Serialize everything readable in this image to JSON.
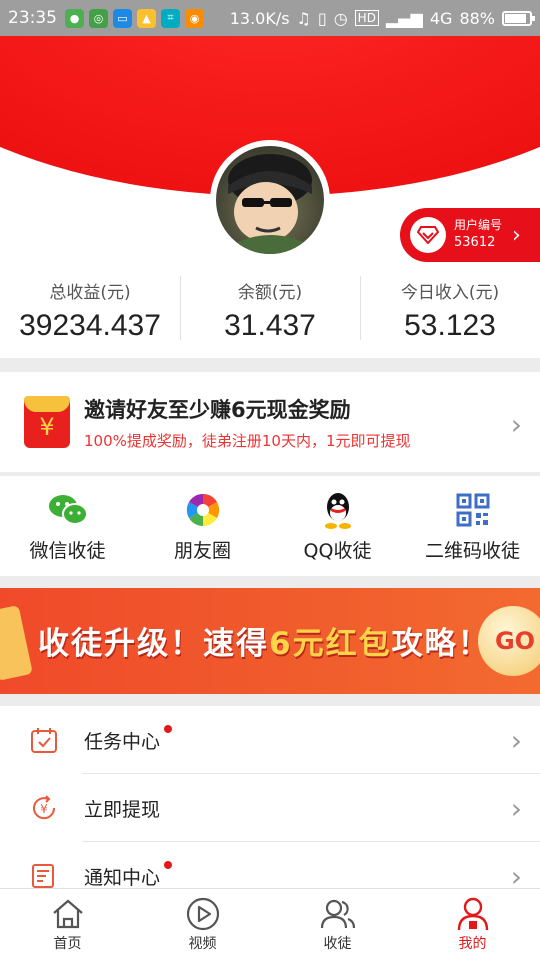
{
  "status_bar": {
    "time": "23:35",
    "network_speed": "13.0K/s",
    "network_type": "4G",
    "battery": "88%",
    "battery_level": 0.88
  },
  "profile": {
    "user_id_label": "用户编号",
    "user_id": "53612"
  },
  "stats": [
    {
      "label": "总收益(元)",
      "value": "39234.437"
    },
    {
      "label": "余额(元)",
      "value": "31.437"
    },
    {
      "label": "今日收入(元)",
      "value": "53.123"
    }
  ],
  "invite": {
    "title": "邀请好友至少赚6元现金奖励",
    "subtitle": "100%提成奖励，徒弟注册10天内，1元即可提现",
    "icon_glyph": "¥"
  },
  "share": [
    {
      "label": "微信收徒",
      "icon": "wechat-icon"
    },
    {
      "label": "朋友圈",
      "icon": "moments-icon"
    },
    {
      "label": "QQ收徒",
      "icon": "qq-icon"
    },
    {
      "label": "二维码收徒",
      "icon": "qrcode-icon"
    }
  ],
  "banner": {
    "text_before": "收徒升级！速得",
    "highlight": "6元红包",
    "text_after": "攻略！",
    "go": "GO"
  },
  "menu": [
    {
      "label": "任务中心",
      "icon": "calendar-check-icon",
      "dot": true
    },
    {
      "label": "立即提现",
      "icon": "withdraw-icon",
      "dot": false
    },
    {
      "label": "通知中心",
      "icon": "notice-icon",
      "dot": true
    }
  ],
  "bottom_nav": [
    {
      "label": "首页",
      "icon": "home-icon"
    },
    {
      "label": "视频",
      "icon": "video-play-icon"
    },
    {
      "label": "收徒",
      "icon": "users-icon"
    },
    {
      "label": "我的",
      "icon": "profile-icon",
      "active": true
    }
  ],
  "colors": {
    "brand_red": "#e60f1a",
    "accent_red": "#e21919",
    "gold": "#ffd34a"
  }
}
